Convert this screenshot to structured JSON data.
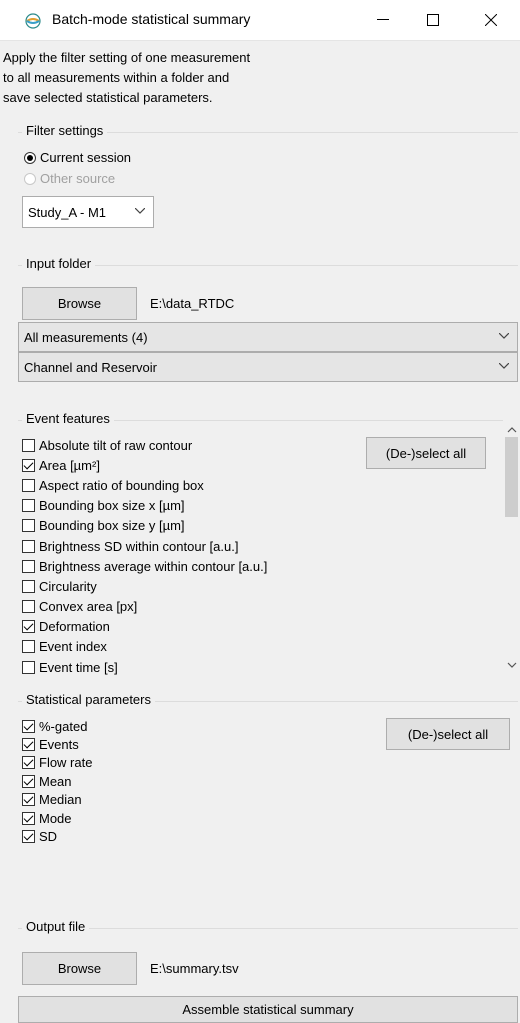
{
  "window": {
    "title": "Batch-mode statistical summary",
    "icons": {
      "app": "app-icon",
      "minimize": "minimize-icon",
      "maximize": "maximize-icon",
      "close": "close-icon"
    }
  },
  "description": [
    "Apply the filter setting of one measurement",
    "to all measurements within a folder and",
    "save selected statistical parameters."
  ],
  "filter_settings": {
    "title": "Filter settings",
    "current_session": "Current session",
    "other_source": "Other source",
    "selected_source": "Study_A - M1"
  },
  "input_folder": {
    "title": "Input folder",
    "browse_label": "Browse",
    "path": "E:\\data_RTDC",
    "measurements": "All measurements (4)",
    "channel": "Channel and Reservoir"
  },
  "event_features": {
    "title": "Event features",
    "toggle_label": "(De-)select all",
    "items": [
      {
        "label": "Absolute tilt of raw contour",
        "checked": false
      },
      {
        "label": "Area [µm²]",
        "checked": true
      },
      {
        "label": "Aspect ratio of bounding box",
        "checked": false
      },
      {
        "label": "Bounding box size x [µm]",
        "checked": false
      },
      {
        "label": "Bounding box size y [µm]",
        "checked": false
      },
      {
        "label": "Brightness SD within contour [a.u.]",
        "checked": false
      },
      {
        "label": "Brightness average within contour [a.u.]",
        "checked": false
      },
      {
        "label": "Circularity",
        "checked": false
      },
      {
        "label": "Convex area [px]",
        "checked": false
      },
      {
        "label": "Deformation",
        "checked": true
      },
      {
        "label": "Event index",
        "checked": false
      },
      {
        "label": "Event time [s]",
        "checked": false
      }
    ]
  },
  "statistical_parameters": {
    "title": "Statistical parameters",
    "toggle_label": "(De-)select all",
    "items": [
      {
        "label": "%-gated",
        "checked": true
      },
      {
        "label": "Events",
        "checked": true
      },
      {
        "label": "Flow rate",
        "checked": true
      },
      {
        "label": "Mean",
        "checked": true
      },
      {
        "label": "Median",
        "checked": true
      },
      {
        "label": "Mode",
        "checked": true
      },
      {
        "label": "SD",
        "checked": true
      }
    ]
  },
  "output_file": {
    "title": "Output file",
    "browse_label": "Browse",
    "path": "E:\\summary.tsv"
  },
  "assemble_label": "Assemble statistical summary"
}
